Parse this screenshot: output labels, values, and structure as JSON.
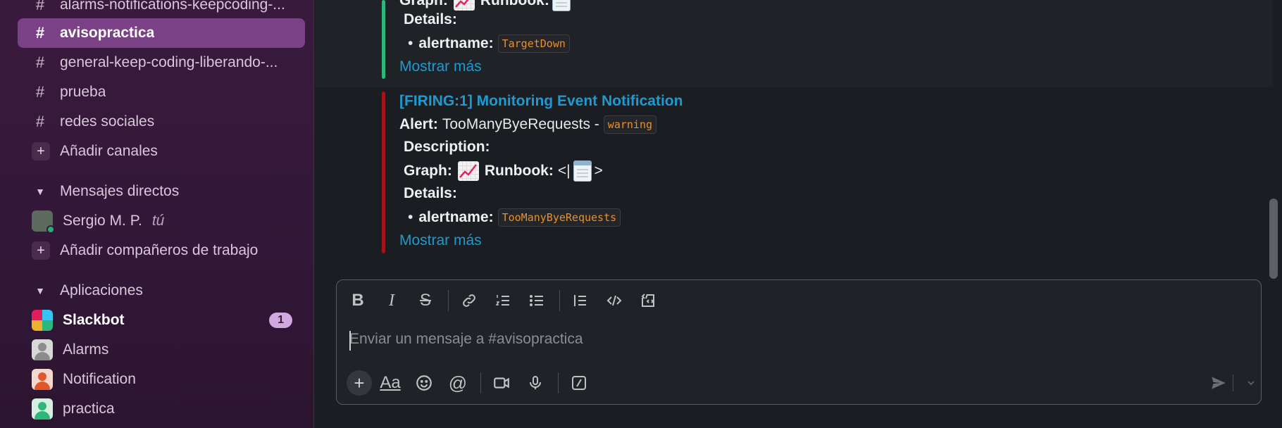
{
  "sidebar": {
    "channels": [
      {
        "label": "alarms-notifications-keepcoding-...",
        "active": false
      },
      {
        "label": "avisopractica",
        "active": true
      },
      {
        "label": "general-keep-coding-liberando-...",
        "active": false
      },
      {
        "label": "prueba",
        "active": false
      },
      {
        "label": "redes sociales",
        "active": false
      }
    ],
    "add_channels": "Añadir canales",
    "dm_section": "Mensajes directos",
    "dm_user": "Sergio M. P.",
    "dm_you": "tú",
    "add_coworkers": "Añadir compañeros de trabajo",
    "apps_section": "Aplicaciones",
    "apps": [
      {
        "label": "Slackbot",
        "badge": "1"
      },
      {
        "label": "Alarms"
      },
      {
        "label": "Notification"
      },
      {
        "label": "practica"
      }
    ]
  },
  "messages": {
    "first": {
      "graph_label": "Graph:",
      "runbook_label": "Runbook:",
      "details_label": "Details:",
      "alertname_label": "alertname:",
      "alertname_value": "TargetDown",
      "show_more": "Mostrar más"
    },
    "second": {
      "title": "[FIRING:1] Monitoring Event Notification",
      "alert_label": "Alert:",
      "alert_text": "TooManyByeRequests -",
      "severity": "warning",
      "description_label": "Description:",
      "graph_label": "Graph:",
      "runbook_label": "Runbook:",
      "runbook_open": "<|",
      "runbook_close": ">",
      "details_label": "Details:",
      "alertname_label": "alertname:",
      "alertname_value": "TooManyByeRequests",
      "show_more": "Mostrar más"
    }
  },
  "composer": {
    "placeholder": "Enviar un mensaje a #avisopractica",
    "format_label": "Aa"
  },
  "colors": {
    "sidebar_bg": "#3a1a3c",
    "active_channel": "#7b4186",
    "link": "#1d9bd1",
    "good": "#2eb67d",
    "danger": "#a3131a",
    "code": "#e8912d"
  }
}
